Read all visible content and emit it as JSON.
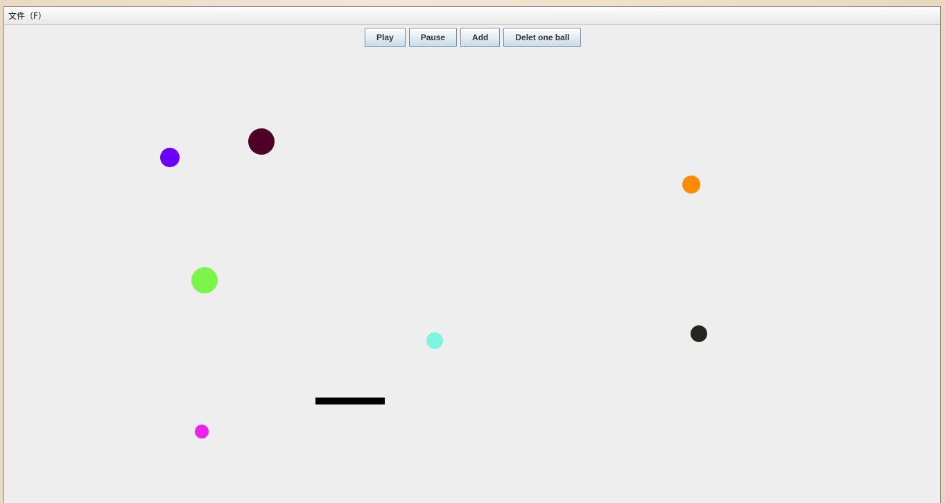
{
  "menu": {
    "file": "文件（F）"
  },
  "toolbar": {
    "play": "Play",
    "pause": "Pause",
    "add": "Add",
    "delete": "Delet one ball"
  },
  "balls": [
    {
      "color": "#6a00ff"
    },
    {
      "color": "#4e0029"
    },
    {
      "color": "#ff8c00"
    },
    {
      "color": "#7cf54a"
    },
    {
      "color": "#7af5e0"
    },
    {
      "color": "#262620"
    },
    {
      "color": "#ee22ee"
    }
  ],
  "paddle": {
    "color": "#000000"
  }
}
